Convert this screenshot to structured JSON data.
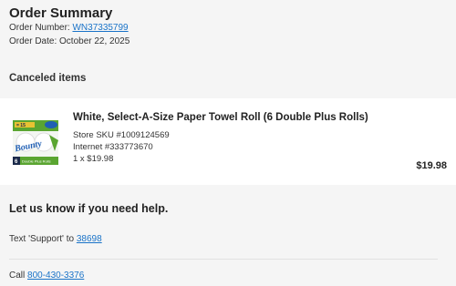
{
  "summary": {
    "title": "Order Summary",
    "order_number_label": "Order Number: ",
    "order_number": "WN37335799",
    "order_date": "Order Date: October 22, 2025"
  },
  "canceled": {
    "heading": "Canceled items",
    "item": {
      "title": "White, Select-A-Size Paper Towel Roll (6 Double Plus Rolls)",
      "store_sku": "Store SKU #1009124569",
      "internet_id": "Internet #333773670",
      "quantity_price": "1 x $19.98",
      "total": "$19.98",
      "image": {
        "brand": "Bounty",
        "count": "6",
        "pack_label": "Double Plus Rolls",
        "promo": "= 15",
        "colors": {
          "blue": "#1f5fb4",
          "green": "#5aa531",
          "dark": "#1b2a4a"
        }
      }
    }
  },
  "help": {
    "heading": "Let us know if you need help.",
    "text_label": "Text 'Support' to ",
    "text_number": "38698",
    "call_label": "Call ",
    "phone": "800-430-3376"
  },
  "colors": {
    "link": "#1a73c8",
    "background": "#f5f5f5",
    "card": "#ffffff"
  }
}
